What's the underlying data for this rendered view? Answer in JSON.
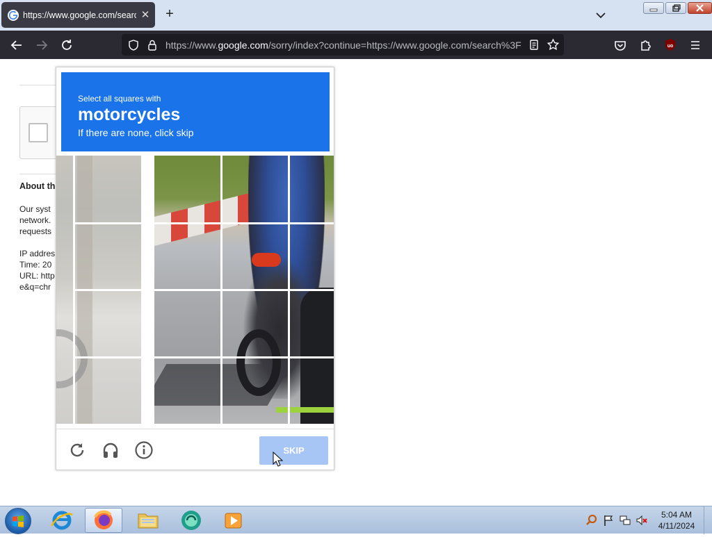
{
  "browser": {
    "tab": {
      "title": "https://www.google.com/search",
      "close_label": "✕"
    },
    "newtab_label": "+",
    "url": {
      "prefix": "https://www.",
      "host": "google.com",
      "rest": "/sorry/index?continue=https://www.google.com/search%3F"
    }
  },
  "page": {
    "about_title": "About th",
    "about_text": "Our syst\nnetwork.\nrequests\n\nIP addres\nTime: 20\nURL: http\ne&q=chr"
  },
  "captcha": {
    "line1": "Select all squares with",
    "target": "motorcycles",
    "line3": "If there are none, click skip",
    "skip_label": "SKIP",
    "colors": {
      "header": "#1a73e8",
      "skip": "#a7c6f5"
    }
  },
  "taskbar": {
    "time": "5:04 AM",
    "date": "4/11/2024"
  }
}
